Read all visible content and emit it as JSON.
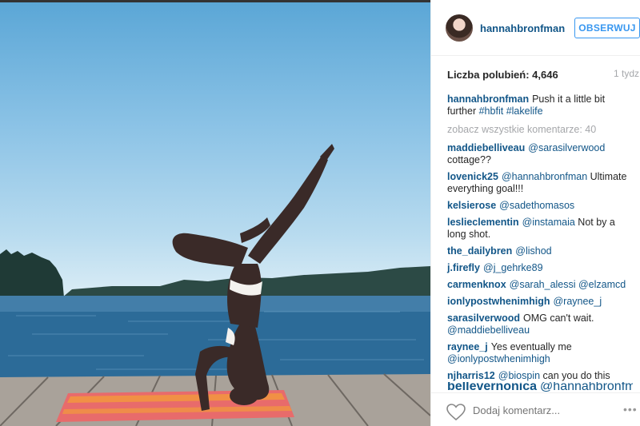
{
  "header": {
    "username": "hannahbronfman",
    "follow_label": "OBSERWUJ"
  },
  "post": {
    "likes": "Liczba polubień: 4,646",
    "time": "1 tydz.",
    "caption": {
      "author": "hannahbronfman",
      "text": "Push it a little bit further ",
      "tags": [
        "#hbfit",
        "#lakelife"
      ]
    },
    "view_all": "zobacz wszystkie komentarze: 40"
  },
  "comments": [
    {
      "author": "maddiebelliveau",
      "mention": "@sarasilverwood",
      "text": " cottage??"
    },
    {
      "author": "lovenick25",
      "mention": "@hannahbronfman",
      "text": " Ultimate everything goal!!!"
    },
    {
      "author": "kelsierose",
      "mention": "@sadethomasos",
      "text": ""
    },
    {
      "author": "leslieclementin",
      "mention": "@instamaia",
      "text": " Not by a long shot."
    },
    {
      "author": "the_dailybren",
      "mention": "@lishod",
      "text": ""
    },
    {
      "author": "j.firefly",
      "mention": "@j_gehrke89",
      "text": ""
    },
    {
      "author": "carmenknox",
      "mention": "@sarah_alessi @elzamcd",
      "text": ""
    },
    {
      "author": "ionlypostwhenimhigh",
      "mention": "@raynee_j",
      "text": ""
    },
    {
      "author": "sarasilverwood",
      "mention": "",
      "text": "OMG can't wait. ",
      "mention2": "@maddiebelliveau"
    },
    {
      "author": "raynee_j",
      "mention": "",
      "text": "Yes eventually me ",
      "mention2": "@ionlypostwhenimhigh"
    },
    {
      "author": "njharris12",
      "mention": "@biospin",
      "text": " can you do this"
    },
    {
      "author": "bellevernonica",
      "mention": "@hannahbronfman",
      "text": " 👀"
    }
  ],
  "footer": {
    "placeholder": "Dodaj komentarz...",
    "more": "•••"
  },
  "icons": {
    "heart": "heart-icon",
    "more": "more-options-icon"
  },
  "colors": {
    "link": "#125688",
    "follow": "#3897f0",
    "muted": "#a5a7aa"
  }
}
